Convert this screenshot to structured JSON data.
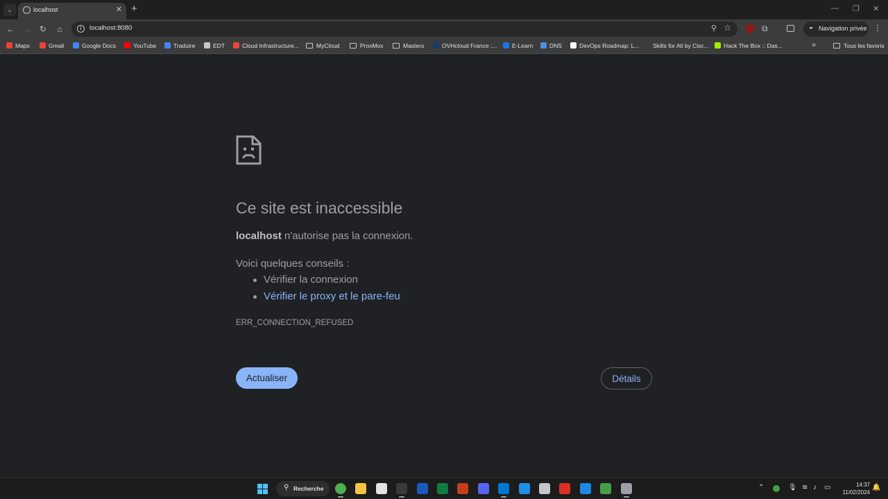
{
  "browser": {
    "tab": {
      "title": "localhost"
    },
    "url": "localhost:8080",
    "incognito_label": "Navigation privée",
    "bookmarks": [
      {
        "label": "Maps",
        "color": "#ea4335",
        "kind": "site"
      },
      {
        "label": "Gmail",
        "color": "#ea4335",
        "kind": "site"
      },
      {
        "label": "Google Docs",
        "color": "#4285f4",
        "kind": "site"
      },
      {
        "label": "YouTube",
        "color": "#ff0000",
        "kind": "site"
      },
      {
        "label": "Traduire",
        "color": "#4285f4",
        "kind": "site"
      },
      {
        "label": "EDT",
        "color": "#c4c7c5",
        "kind": "site"
      },
      {
        "label": "Cloud Infrastructure...",
        "color": "#e8453c",
        "kind": "site"
      },
      {
        "label": "MyCloud",
        "color": "",
        "kind": "folder"
      },
      {
        "label": "ProxMox",
        "color": "",
        "kind": "folder"
      },
      {
        "label": "Masters",
        "color": "",
        "kind": "folder"
      },
      {
        "label": "OVHcloud France :...",
        "color": "#123f6d",
        "kind": "site"
      },
      {
        "label": "E-Learn",
        "color": "#1a73e8",
        "kind": "site"
      },
      {
        "label": "DNS",
        "color": "#4a90e2",
        "kind": "site"
      },
      {
        "label": "DevOps Roadmap: L...",
        "color": "#ffffff",
        "kind": "site"
      },
      {
        "label": "Skills for All by Cisc...",
        "color": "#3c3c3c",
        "kind": "site"
      },
      {
        "label": "Hack The Box :: Das...",
        "color": "#9fef00",
        "kind": "site"
      }
    ],
    "all_bookmarks_label": "Tous les favoris"
  },
  "error_page": {
    "title": "Ce site est inaccessible",
    "host": "localhost",
    "host_message": " n'autorise pas la connexion.",
    "suggestions_heading": "Voici quelques conseils :",
    "suggestions": [
      {
        "text": "Vérifier la connexion",
        "link": false
      },
      {
        "text": "Vérifier le proxy et le pare-feu",
        "link": true
      }
    ],
    "error_code": "ERR_CONNECTION_REFUSED",
    "reload_label": "Actualiser",
    "details_label": "Détails"
  },
  "taskbar": {
    "search_label": "Recherche",
    "apps": [
      {
        "name": "chrome",
        "color": "#4caf50",
        "active": true
      },
      {
        "name": "file-explorer",
        "color": "#f6c342",
        "active": false
      },
      {
        "name": "store",
        "color": "#e3e3e3",
        "active": false
      },
      {
        "name": "terminal",
        "color": "#3a3a3a",
        "active": true
      },
      {
        "name": "word",
        "color": "#185abd",
        "active": false
      },
      {
        "name": "excel",
        "color": "#107c41",
        "active": false
      },
      {
        "name": "powerpoint",
        "color": "#c43e1c",
        "active": false
      },
      {
        "name": "discord",
        "color": "#5865f2",
        "active": false
      },
      {
        "name": "vscode",
        "color": "#0078d4",
        "active": true
      },
      {
        "name": "docker",
        "color": "#1d91e6",
        "active": false
      },
      {
        "name": "virtualbox",
        "color": "#c4c7c5",
        "active": false
      },
      {
        "name": "app-red",
        "color": "#d93025",
        "active": false
      },
      {
        "name": "app-blue",
        "color": "#1e88e5",
        "active": false
      },
      {
        "name": "app-green",
        "color": "#43a047",
        "active": false
      },
      {
        "name": "app-settings",
        "color": "#9aa0a6",
        "active": true
      }
    ],
    "time": "14:37",
    "date": "11/02/2024"
  }
}
